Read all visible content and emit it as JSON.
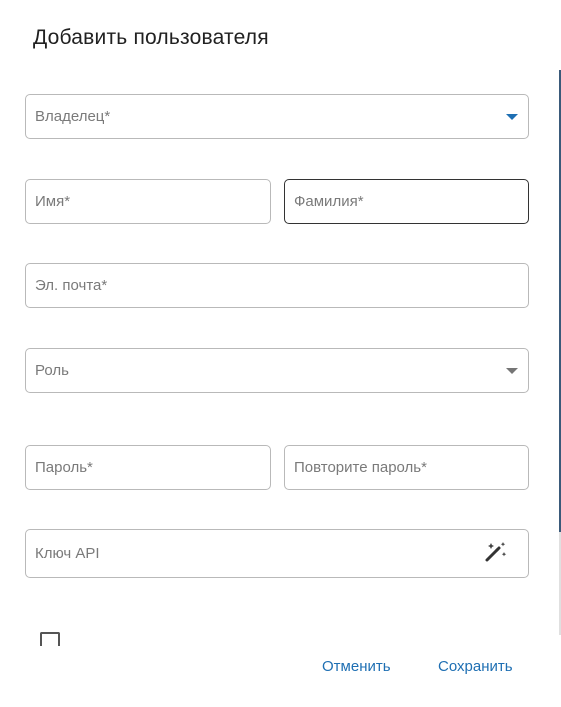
{
  "dialog": {
    "title": "Добавить пользователя"
  },
  "form": {
    "owner": {
      "placeholder": "Владелец*"
    },
    "first_name": {
      "placeholder": "Имя*"
    },
    "last_name": {
      "placeholder": "Фамилия*"
    },
    "email": {
      "placeholder": "Эл. почта*"
    },
    "role": {
      "placeholder": "Роль"
    },
    "password": {
      "placeholder": "Пароль*"
    },
    "password_repeat": {
      "placeholder": "Повторите пароль*"
    },
    "api_key": {
      "placeholder": "Ключ API",
      "generate_icon": "magic-wand-icon"
    }
  },
  "actions": {
    "cancel_label": "Отменить",
    "save_label": "Сохранить"
  },
  "colors": {
    "accent": "#1e6fb3",
    "border": "#b9b9b9",
    "focused_border": "#333333",
    "placeholder": "#7a7a7a"
  }
}
